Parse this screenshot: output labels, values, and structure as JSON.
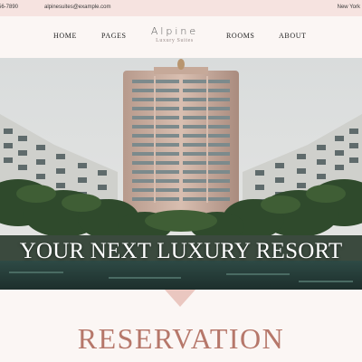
{
  "topbar": {
    "phone": "56-7890",
    "email": "alpinesuites@example.com",
    "city": "New York"
  },
  "nav": {
    "home": "HOME",
    "pages": "PAGES",
    "rooms": "ROOMS",
    "about": "ABOUT"
  },
  "logo": {
    "title": "Alpine",
    "subtitle": "Luxury Suites"
  },
  "hero": {
    "headline": "YOUR NEXT LUXURY RESORT"
  },
  "reservation": {
    "title": "RESERVATION"
  },
  "colors": {
    "topbar_bg": "#f6e3e0",
    "page_bg": "#fbf6f4",
    "accent": "#b6776a",
    "marker": "#eac7c0"
  }
}
